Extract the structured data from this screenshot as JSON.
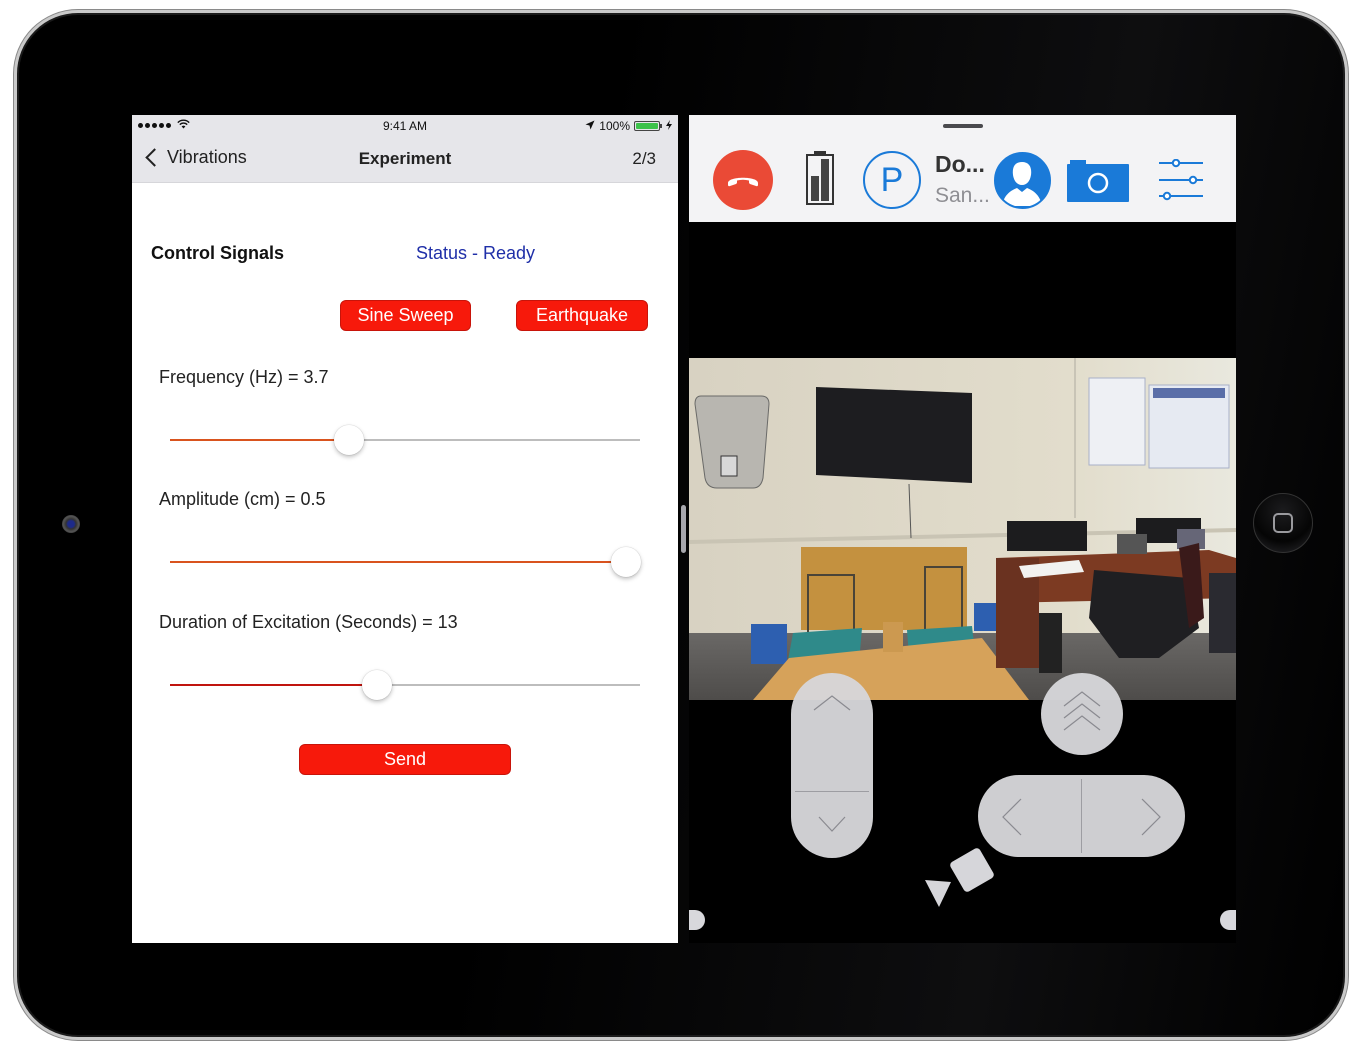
{
  "device": {
    "home_button_icon": "home-button-square",
    "front_camera_icon": "front-camera-lens"
  },
  "left_app": {
    "status_bar": {
      "signal_dots": 5,
      "wifi_icon": "wifi-icon",
      "time": "9:41 AM",
      "location_icon": "location-arrow-icon",
      "battery_percent": "100%",
      "battery_level": 1.0,
      "battery_color": "#3cc24a",
      "charging_icon": "bolt-icon"
    },
    "nav": {
      "back_label": "Vibrations",
      "back_icon": "chevron-left-icon",
      "title": "Experiment",
      "page_indicator": "2/3"
    },
    "control": {
      "title": "Control Signals",
      "status": "Status - Ready",
      "status_color": "#1f2fa8",
      "buttons": {
        "sine_sweep": "Sine Sweep",
        "earthquake": "Earthquake",
        "send": "Send"
      },
      "button_color": "#f7190b"
    },
    "params": [
      {
        "label": "Frequency (Hz) = 3.7",
        "value_fraction": 0.38,
        "fill_color": "#d9531e"
      },
      {
        "label": "Amplitude (cm) = 0.5",
        "value_fraction": 0.97,
        "fill_color": "#d9531e"
      },
      {
        "label": "Duration of Excitation (Seconds) = 13",
        "value_fraction": 0.44,
        "fill_color": "#c0140e"
      }
    ]
  },
  "right_app": {
    "toolbar": {
      "hangup_icon": "hang-up-phone-icon",
      "hangup_color": "#ea4a36",
      "robot_battery_icon": "battery-level-icon",
      "park_icon": "park-p-icon",
      "park_label": "P",
      "caller_name": "Do...",
      "caller_subtitle": "San...",
      "avatar_icon": "user-avatar-icon",
      "camera_icon": "camera-icon",
      "settings_icon": "sliders-settings-icon",
      "accent_color": "#1a7ad8"
    },
    "video": {
      "description": "Live video feed of lab room with wall TV, shake tables, and desk with monitors"
    },
    "controls": {
      "forward_icon": "chevron-up-icon",
      "backward_icon": "chevron-down-icon",
      "fast_forward_icon": "triple-chevron-up-icon",
      "turn_left_icon": "chevron-left-icon",
      "turn_right_icon": "chevron-right-icon",
      "camera_mode_icon": "video-camera-icon"
    }
  }
}
